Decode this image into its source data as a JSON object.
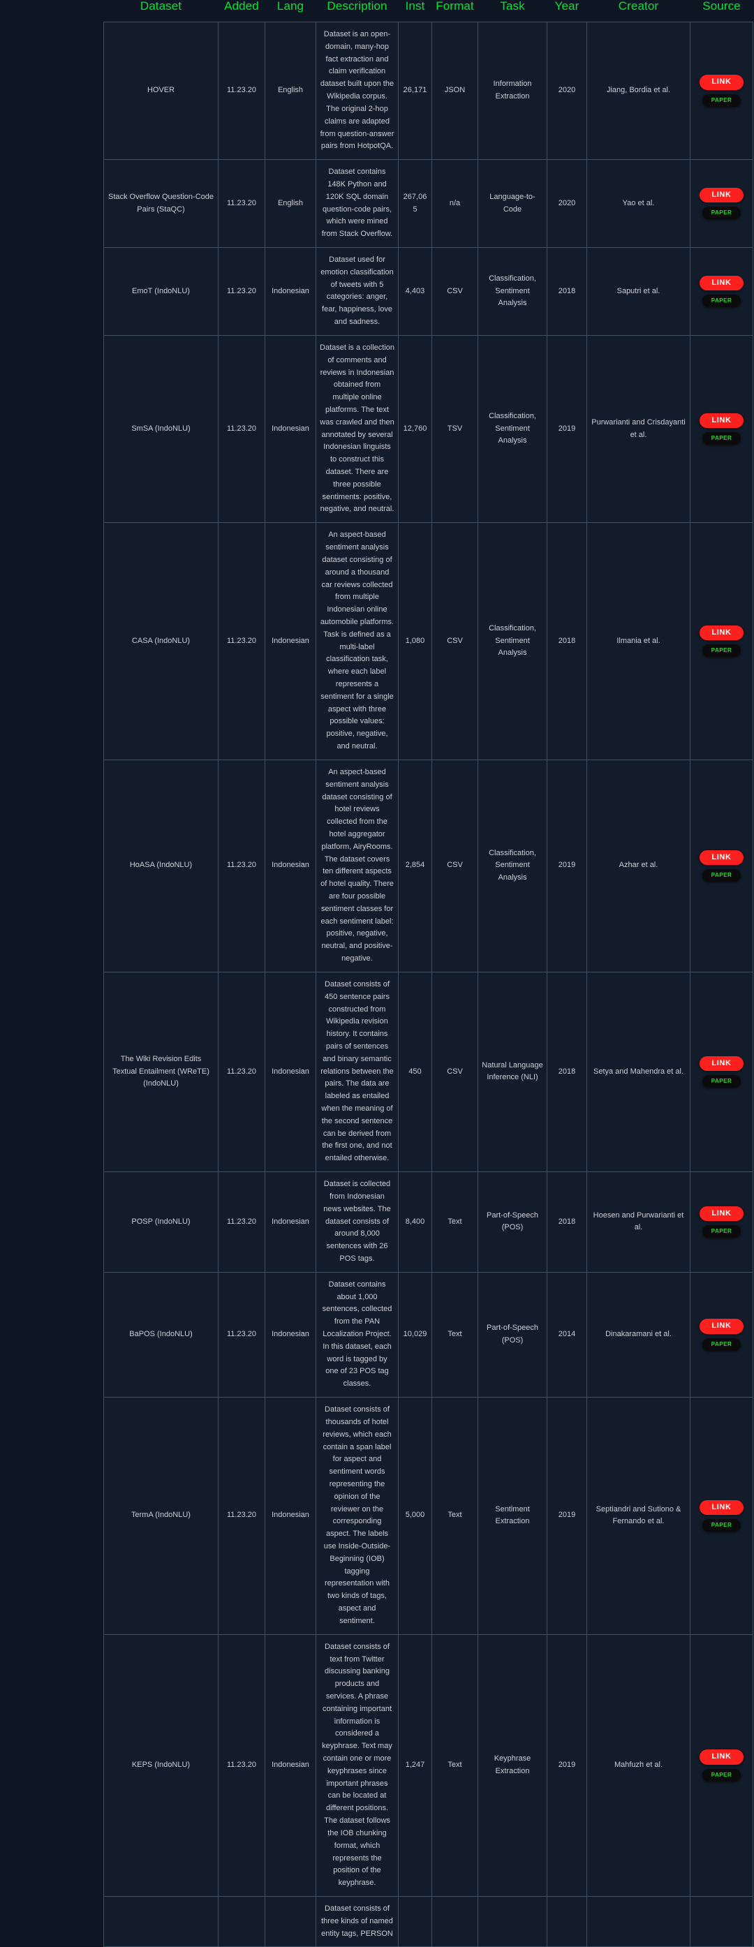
{
  "table": {
    "columns": [
      {
        "key": "dataset",
        "label": "Dataset"
      },
      {
        "key": "added",
        "label": "Added"
      },
      {
        "key": "lang",
        "label": "Lang"
      },
      {
        "key": "description",
        "label": "Description"
      },
      {
        "key": "inst",
        "label": "Inst"
      },
      {
        "key": "format",
        "label": "Format"
      },
      {
        "key": "task",
        "label": "Task"
      },
      {
        "key": "year",
        "label": "Year"
      },
      {
        "key": "creator",
        "label": "Creator"
      },
      {
        "key": "source",
        "label": "Source"
      }
    ],
    "source_buttons": {
      "link_label": "LINK",
      "paper_label": "PAPER"
    },
    "colors": {
      "page_background": "#0d1622",
      "cell_background": "#121c2a",
      "cell_border": "#40505f",
      "header_text": "#00e533",
      "body_text": "#c9ced6",
      "link_button_bg": "#ff1f1f",
      "link_button_text": "#ffffff",
      "paper_button_bg": "#0b0b0b",
      "paper_button_text": "#22dd22"
    },
    "rows": [
      {
        "dataset": "HOVER",
        "added": "11.23.20",
        "lang": "English",
        "description": "Dataset is an open-domain, many-hop fact extraction and claim verification dataset built upon the Wikipedia corpus. The original 2-hop claims are adapted from question-answer pairs from HotpotQA.",
        "inst": "26,171",
        "format": "JSON",
        "task": "Information Extraction",
        "year": "2020",
        "creator": "Jiang, Bordia et al.",
        "has_link": true,
        "has_paper": true
      },
      {
        "dataset": "Stack Overflow Question-Code Pairs (StaQC)",
        "added": "11.23.20",
        "lang": "English",
        "description": "Dataset contains 148K Python and 120K SQL domain question-code pairs, which were mined from Stack Overflow.",
        "inst": "267,065",
        "format": "n/a",
        "task": "Language-to-Code",
        "year": "2020",
        "creator": "Yao et al.",
        "has_link": true,
        "has_paper": true
      },
      {
        "dataset": "EmoT (IndoNLU)",
        "added": "11.23.20",
        "lang": "Indonesian",
        "description": "Dataset used for emotion classification of tweets with 5 categories: anger, fear, happiness, love and sadness.",
        "inst": "4,403",
        "format": "CSV",
        "task": "Classification, Sentiment Analysis",
        "year": "2018",
        "creator": "Saputri et al.",
        "has_link": true,
        "has_paper": true
      },
      {
        "dataset": "SmSA (IndoNLU)",
        "added": "11.23.20",
        "lang": "Indonesian",
        "description": "Dataset is a collection of comments and reviews in Indonesian obtained from multiple online platforms. The text was crawled and then annotated by several Indonesian linguists to construct this dataset. There are three possible sentiments: positive, negative, and neutral.",
        "inst": "12,760",
        "format": "TSV",
        "task": "Classification, Sentiment Analysis",
        "year": "2019",
        "creator": "Purwarianti and Crisdayanti et al.",
        "has_link": true,
        "has_paper": true
      },
      {
        "dataset": "CASA (IndoNLU)",
        "added": "11.23.20",
        "lang": "Indonesian",
        "description": "An aspect-based sentiment analysis dataset consisting of around a thousand car reviews collected from multiple Indonesian online automobile platforms. Task is defined as a multi-label classification task, where each label represents a sentiment for a single aspect with three possible values: positive, negative, and neutral.",
        "inst": "1,080",
        "format": "CSV",
        "task": "Classification, Sentiment Analysis",
        "year": "2018",
        "creator": "Ilmania et al.",
        "has_link": true,
        "has_paper": true
      },
      {
        "dataset": "HoASA (IndoNLU)",
        "added": "11.23.20",
        "lang": "Indonesian",
        "description": "An aspect-based sentiment analysis dataset consisting of hotel reviews collected from the hotel aggregator platform, AiryRooms. The dataset covers ten different aspects of hotel quality. There are four possible sentiment classes for each sentiment label: positive, negative, neutral, and positive-negative.",
        "inst": "2,854",
        "format": "CSV",
        "task": "Classification, Sentiment Analysis",
        "year": "2019",
        "creator": "Azhar et al.",
        "has_link": true,
        "has_paper": true
      },
      {
        "dataset": "The Wiki Revision Edits Textual Entailment (WReTE) (IndoNLU)",
        "added": "11.23.20",
        "lang": "Indonesian",
        "description": "Dataset consists of 450 sentence pairs constructed from Wikipedia revision history. It contains pairs of sentences and binary semantic relations between the pairs. The data are labeled as entailed when the meaning of the second sentence can be derived from the first one, and not entailed otherwise.",
        "inst": "450",
        "format": "CSV",
        "task": "Natural Language Inference (NLI)",
        "year": "2018",
        "creator": "Setya and Mahendra et al.",
        "has_link": true,
        "has_paper": true
      },
      {
        "dataset": "POSP (IndoNLU)",
        "added": "11.23.20",
        "lang": "Indonesian",
        "description": "Dataset is collected from Indonesian news websites. The dataset consists of around 8,000 sentences with 26 POS tags.",
        "inst": "8,400",
        "format": "Text",
        "task": "Part-of-Speech (POS)",
        "year": "2018",
        "creator": "Hoesen and Purwarianti et al.",
        "has_link": true,
        "has_paper": true
      },
      {
        "dataset": "BaPOS (IndoNLU)",
        "added": "11.23.20",
        "lang": "Indonesian",
        "description": "Dataset contains about 1,000 sentences, collected from the PAN Localization Project. In this dataset, each word is tagged by one of 23 POS tag classes.",
        "inst": "10,029",
        "format": "Text",
        "task": "Part-of-Speech (POS)",
        "year": "2014",
        "creator": "Dinakaramani et al.",
        "has_link": true,
        "has_paper": true
      },
      {
        "dataset": "TermA (IndoNLU)",
        "added": "11.23.20",
        "lang": "Indonesian",
        "description": "Dataset consists of thousands of hotel reviews, which each contain a span label for aspect and sentiment words representing the opinion of the reviewer on the corresponding aspect. The labels use Inside-Outside-Beginning (IOB) tagging representation with two kinds of tags, aspect and sentiment.",
        "inst": "5,000",
        "format": "Text",
        "task": "Sentiment Extraction",
        "year": "2019",
        "creator": "Septiandri and Sutiono & Fernando et al.",
        "has_link": true,
        "has_paper": true
      },
      {
        "dataset": "KEPS (IndoNLU)",
        "added": "11.23.20",
        "lang": "Indonesian",
        "description": "Dataset consists of text from Twitter discussing banking products and services. A phrase containing important information is considered a keyphrase. Text may contain one or more keyphrases since important phrases can be located at different positions. The dataset follows the IOB chunking format, which represents the position of the keyphrase.",
        "inst": "1,247",
        "format": "Text",
        "task": "Keyphrase Extraction",
        "year": "2019",
        "creator": "Mahfuzh et al.",
        "has_link": true,
        "has_paper": true
      },
      {
        "dataset": "",
        "added": "",
        "lang": "",
        "description": "Dataset consists of three kinds of named entity tags, PERSON",
        "inst": "",
        "format": "",
        "task": "",
        "year": "",
        "creator": "",
        "has_link": false,
        "has_paper": false
      }
    ]
  }
}
